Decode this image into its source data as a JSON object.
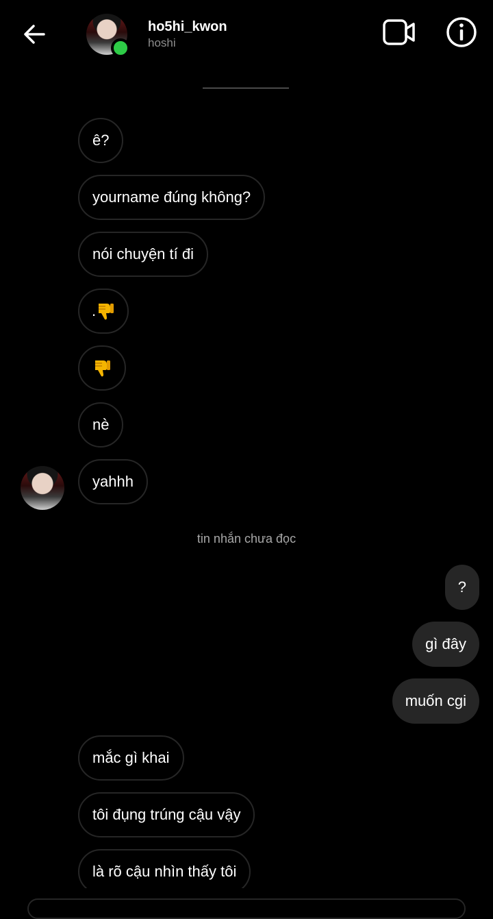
{
  "header": {
    "username": "ho5hi_kwon",
    "display_name": "hoshi",
    "back_icon": "arrow-left-icon",
    "video_icon": "video-camera-icon",
    "info_icon": "info-circle-icon",
    "online_color": "#2ecc47"
  },
  "messages_before": [
    {
      "text": "ê?"
    },
    {
      "text": "yourname đúng không?"
    },
    {
      "text": "nói chuyện tí đi"
    },
    {
      "text": ".",
      "emoji": "thumbs-down-icon"
    },
    {
      "text": "",
      "emoji": "thumbs-down-icon"
    },
    {
      "text": "nè"
    },
    {
      "text": "yahhh"
    }
  ],
  "unread_label": "tin nhắn chưa đọc",
  "messages_out": [
    {
      "text": "?"
    },
    {
      "text": "gì đây"
    },
    {
      "text": "muốn cgi"
    }
  ],
  "messages_after": [
    {
      "text": "mắc gì khai"
    },
    {
      "text": "tôi đụng trúng cậu vậy"
    },
    {
      "text": "là rõ cậu nhìn thấy tôi"
    }
  ],
  "colors": {
    "background": "#000000",
    "bubble_border": "#262626",
    "outgoing_bubble": "#262626",
    "muted_text": "#8e8e8e"
  }
}
